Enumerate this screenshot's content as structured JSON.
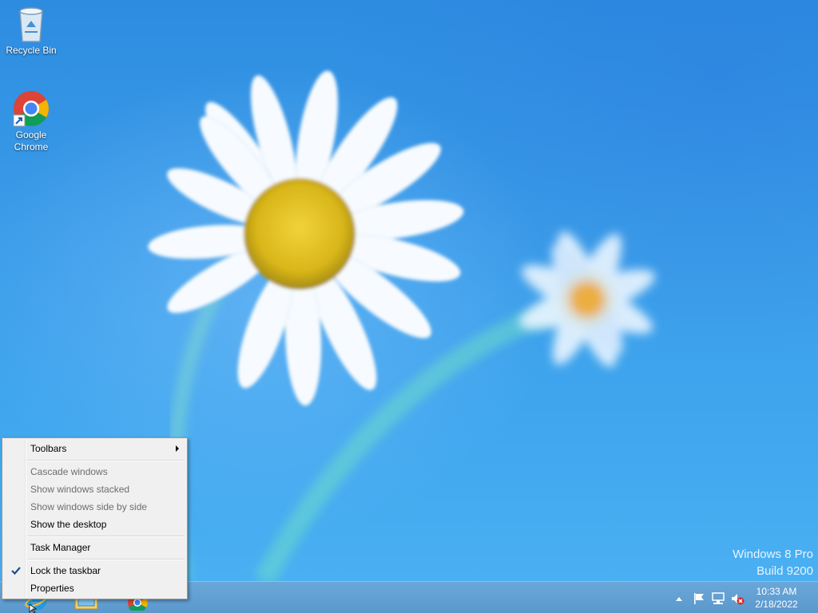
{
  "desktop": {
    "icons": [
      {
        "label": "Recycle Bin",
        "icon": "recycle-bin-icon"
      },
      {
        "label": "Google\nChrome",
        "label_line1": "Google",
        "label_line2": "Chrome",
        "icon": "chrome-icon"
      }
    ],
    "watermark": {
      "line1": "Windows 8 Pro",
      "line2": "Build 9200"
    }
  },
  "context_menu": {
    "items": [
      {
        "label": "Toolbars",
        "enabled": true,
        "submenu": true
      },
      {
        "label": "Cascade windows",
        "enabled": false
      },
      {
        "label": "Show windows stacked",
        "enabled": false
      },
      {
        "label": "Show windows side by side",
        "enabled": false
      },
      {
        "label": "Show the desktop",
        "enabled": true
      },
      {
        "label": "Task Manager",
        "enabled": true
      },
      {
        "label": "Lock the taskbar",
        "enabled": true,
        "checked": true
      },
      {
        "label": "Properties",
        "enabled": true
      }
    ]
  },
  "taskbar": {
    "pinned": [
      "internet-explorer-icon",
      "file-explorer-icon",
      "chrome-icon"
    ],
    "tray": [
      "show-hidden-icons-icon",
      "action-center-flag-icon",
      "network-icon",
      "volume-muted-icon"
    ],
    "clock": {
      "time": "10:33 AM",
      "date": "2/18/2022"
    }
  },
  "colors": {
    "sky": "#3b9ce9",
    "taskbar": "#5b98cc",
    "menu_bg": "#f0f0f0",
    "daisy_center": "#e3c21e"
  }
}
